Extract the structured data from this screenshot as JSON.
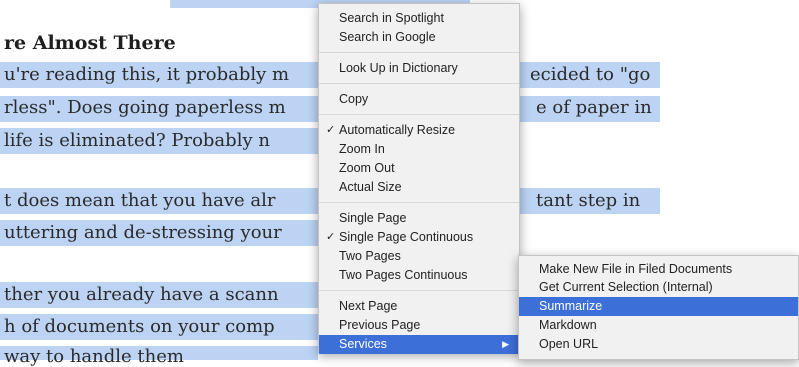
{
  "document": {
    "heading": "re Almost There",
    "lines": [
      "u're reading this, it probably m",
      "rless\".  Does going paperless m",
      "life is eliminated? Probably n",
      "t does mean that you have alr",
      "uttering and de-stressing your",
      "ther you already have a scann",
      "h of documents on your comp",
      "way to handle them"
    ],
    "right_fragments": [
      "ecided to \"go",
      "e of paper in",
      "tant step in"
    ]
  },
  "context_menu": {
    "items": [
      {
        "label": "Search in Spotlight"
      },
      {
        "label": "Search in Google"
      },
      {
        "label": "Look Up in Dictionary"
      },
      {
        "label": "Copy"
      },
      {
        "label": "Automatically Resize",
        "checked": true
      },
      {
        "label": "Zoom In"
      },
      {
        "label": "Zoom Out"
      },
      {
        "label": "Actual Size"
      },
      {
        "label": "Single Page"
      },
      {
        "label": "Single Page Continuous",
        "checked": true
      },
      {
        "label": "Two Pages"
      },
      {
        "label": "Two Pages Continuous"
      },
      {
        "label": "Next Page"
      },
      {
        "label": "Previous Page"
      },
      {
        "label": "Services",
        "highlighted": true,
        "has_submenu": true
      }
    ],
    "check_glyph": "✓",
    "submenu_arrow": "▶"
  },
  "services_submenu": {
    "items": [
      {
        "label": "Make New File in Filed Documents"
      },
      {
        "label": "Get Current Selection (Internal)"
      },
      {
        "label": "Summarize",
        "highlighted": true
      },
      {
        "label": "Markdown"
      },
      {
        "label": "Open URL"
      }
    ]
  },
  "colors": {
    "selection": "#bcd3f4",
    "menu_highlight": "#3d6fd9"
  }
}
